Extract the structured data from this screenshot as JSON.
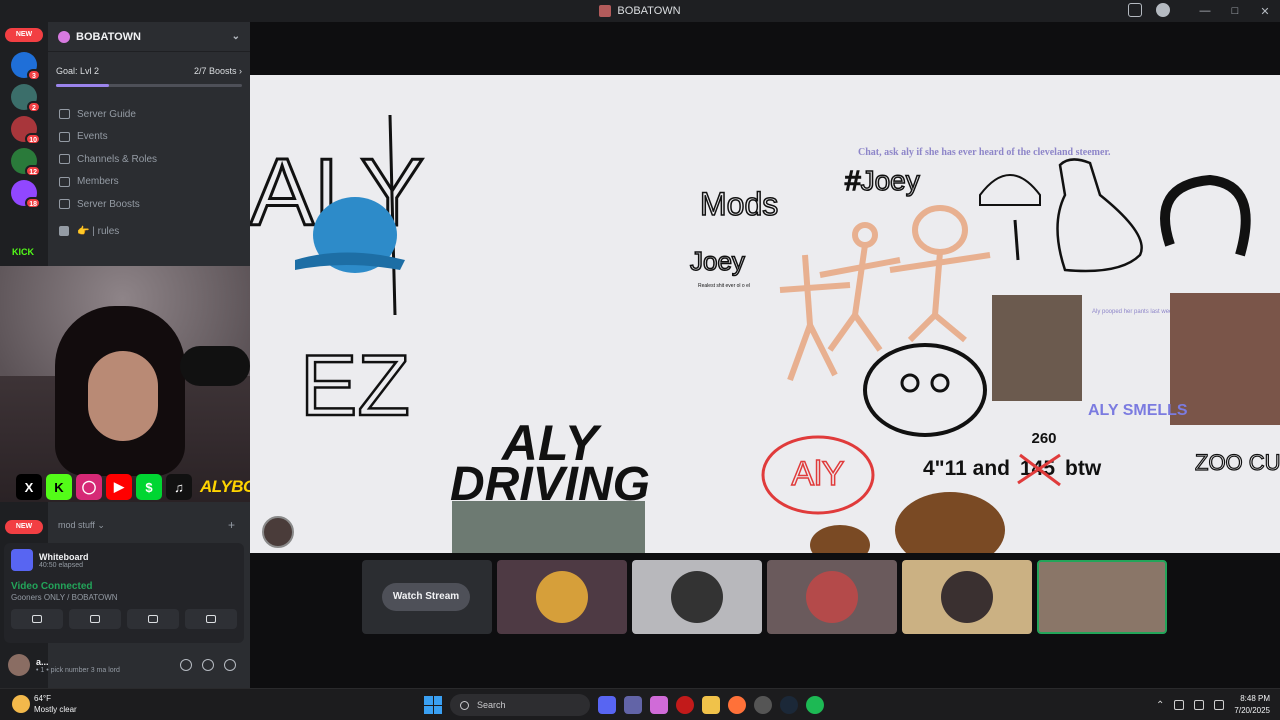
{
  "window": {
    "title": "BOBATOWN"
  },
  "guilds": {
    "new_label_top": "NEW",
    "new_label_bottom": "NEW",
    "badges": [
      "3",
      "2",
      "10",
      "12",
      "18"
    ],
    "kick_label": "KICK"
  },
  "server": {
    "name": "BOBATOWN",
    "goal_label": "Goal: Lvl 2",
    "boosts_label": "2/7 Boosts",
    "goal_progress": 0.285,
    "nav": [
      "Server Guide",
      "Events",
      "Channels & Roles",
      "Members",
      "Server Boosts"
    ],
    "rules_label": "| rules",
    "category": "mod stuff"
  },
  "stream_overlay": {
    "handle": "ALYBOBA",
    "socials": [
      "x-icon",
      "kick-icon",
      "instagram-icon",
      "youtube-icon",
      "cashapp-icon",
      "tiktok-icon"
    ]
  },
  "activity": {
    "title": "Whiteboard",
    "elapsed": "40:50 elapsed"
  },
  "voice": {
    "status": "Video Connected",
    "channel": "Gooners ONLY / BOBATOWN"
  },
  "user": {
    "name": "a...",
    "status": "• 1 • pick number 3 ma lord"
  },
  "whiteboard": {
    "chat_note": "Chat, ask aly if she has ever heard of the cleveland steemer.",
    "mods_label": "Mods",
    "joey_label": "Joey",
    "joey_hash": "#Joey",
    "realest": "Realest shit ever ol o el",
    "aly_pooped": "Aly pooped her pants last week",
    "aly_driving_1": "ALY",
    "aly_driving_2": "DRIVING",
    "height_text": "4\"11 and",
    "weight_old": "145",
    "weight_suffix": "btw",
    "weight_new": "260",
    "aly_circle": "AlY",
    "zoo_cult": "ZOO CULT",
    "aly_smells": "ALY SMELLS",
    "big_letters": "EZ",
    "big_aly": "ALY"
  },
  "watch": {
    "button": "Watch Stream"
  },
  "taskbar": {
    "temp": "64°F",
    "weather": "Mostly clear",
    "search": "Search",
    "time": "8:48 PM",
    "date": "7/20/2025"
  },
  "colors": {
    "accent": "#5865f2",
    "connected": "#23a55a",
    "badge": "#f23f43",
    "kick": "#53fc18",
    "handle": "#ffd400"
  }
}
